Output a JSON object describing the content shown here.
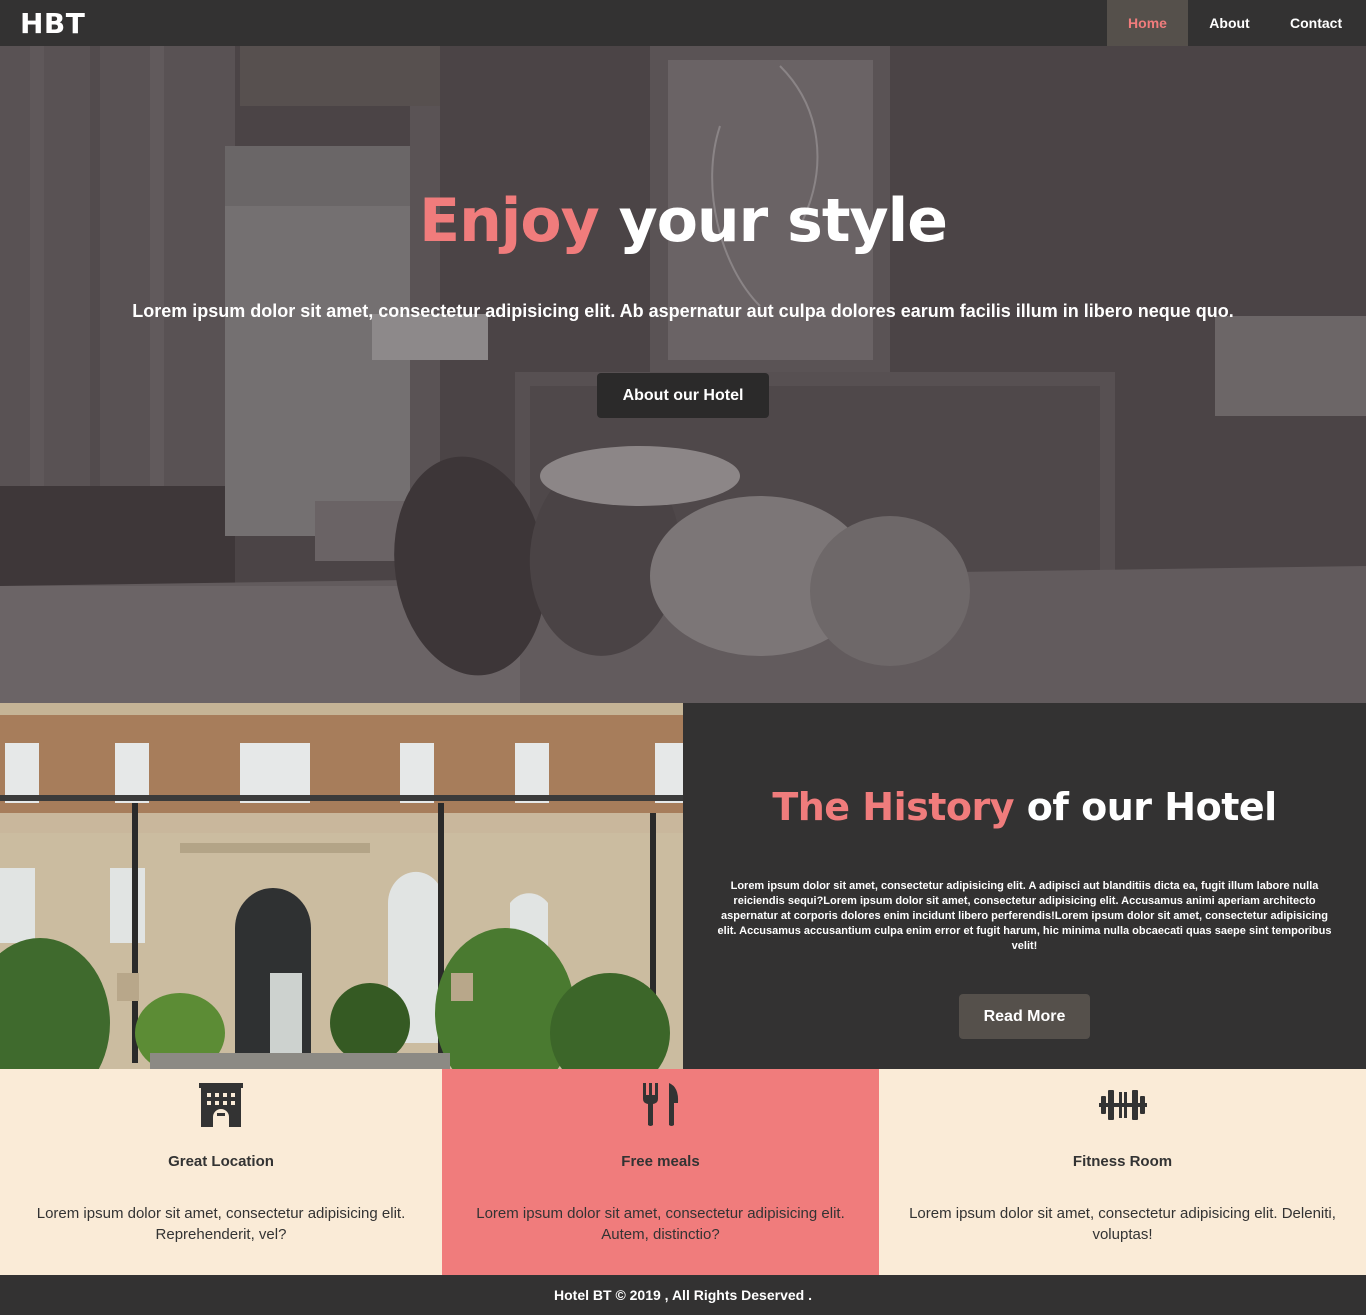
{
  "nav": {
    "brand": "HBT",
    "links": [
      "Home",
      "About",
      "Contact"
    ]
  },
  "hero": {
    "title_accent": "Enjoy",
    "title_rest": "your style",
    "subtitle": "Lorem ipsum dolor sit amet, consectetur adipisicing elit. Ab aspernatur aut culpa dolores earum facilis illum in libero neque quo.",
    "button": "About our Hotel"
  },
  "history": {
    "title_accent": "The History",
    "title_rest": "of our Hotel",
    "body": "Lorem ipsum dolor sit amet, consectetur adipisicing elit. A adipisci aut blanditiis dicta ea, fugit illum labore nulla reiciendis sequi?Lorem ipsum dolor sit amet, consectetur adipisicing elit. Accusamus animi aperiam architecto aspernatur at corporis dolores enim incidunt libero perferendis!Lorem ipsum dolor sit amet, consectetur adipisicing elit. Accusamus accusantium culpa enim error et fugit harum, hic minima nulla obcaecati quas saepe sint temporibus velit!",
    "button": "Read More"
  },
  "features": [
    {
      "icon": "building-icon",
      "title": "Great Location",
      "desc": "Lorem ipsum dolor sit amet, consectetur adipisicing elit. Reprehenderit, vel?"
    },
    {
      "icon": "utensils-icon",
      "title": "Free meals",
      "desc": "Lorem ipsum dolor sit amet, consectetur adipisicing elit. Autem, distinctio?"
    },
    {
      "icon": "dumbbell-icon",
      "title": "Fitness Room",
      "desc": "Lorem ipsum dolor sit amet, consectetur adipisicing elit. Deleniti, voluptas!"
    }
  ],
  "footer": {
    "text": "Hotel BT © 2019 , All Rights Deserved ."
  },
  "colors": {
    "accent": "#f07c7c",
    "dark": "#333232",
    "button_brown": "#55504b",
    "cream": "#faebd7"
  }
}
